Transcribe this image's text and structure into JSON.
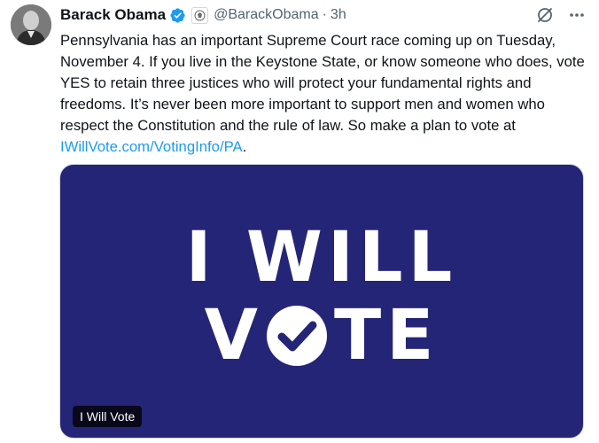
{
  "author": {
    "name": "Barack Obama",
    "handle": "@BarackObama",
    "separator": "·",
    "time": "3h"
  },
  "tweet": {
    "text": "Pennsylvania has an important Supreme Court race coming up on Tuesday, November 4. If you live in the Keystone State, or know someone who does, vote YES to retain three justices who will protect your fundamental rights and freedoms. It’s never been more important to support men and women who respect the Constitution and the rule of law. So make a plan to vote at ",
    "link": "IWillVote.com/VotingInfo/PA",
    "after_link": "."
  },
  "media": {
    "line1": "I WILL",
    "line2_start": "V",
    "line2_end": "TE",
    "label": "I Will Vote",
    "bg_color": "#252577"
  },
  "icons": [
    "verified-badge-icon",
    "affiliation-seal-icon",
    "grok-icon",
    "more-icon"
  ]
}
